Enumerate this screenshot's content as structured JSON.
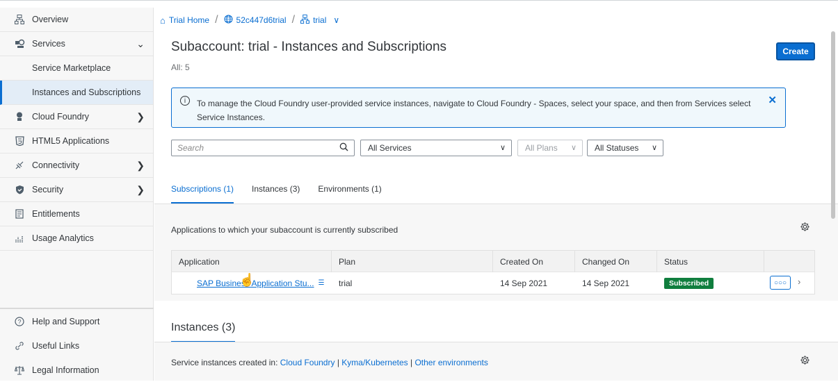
{
  "sidebar": {
    "items": [
      {
        "label": "Overview",
        "icon": "hierarchy-icon"
      },
      {
        "label": "Services",
        "icon": "services-icon"
      },
      {
        "label": "Service Marketplace"
      },
      {
        "label": "Instances and Subscriptions"
      },
      {
        "label": "Cloud Foundry",
        "icon": "cloud-foundry-icon"
      },
      {
        "label": "HTML5 Applications",
        "icon": "html5-icon"
      },
      {
        "label": "Connectivity",
        "icon": "connectivity-icon"
      },
      {
        "label": "Security",
        "icon": "shield-icon"
      },
      {
        "label": "Entitlements",
        "icon": "entitlements-icon"
      },
      {
        "label": "Usage Analytics",
        "icon": "analytics-icon"
      }
    ],
    "bottom": [
      {
        "label": "Help and Support",
        "icon": "help-icon"
      },
      {
        "label": "Useful Links",
        "icon": "link-icon"
      },
      {
        "label": "Legal Information",
        "icon": "legal-icon"
      }
    ]
  },
  "breadcrumb": {
    "home": "Trial Home",
    "account": "52c447d6trial",
    "subaccount": "trial"
  },
  "header": {
    "title": "Subaccount: trial - Instances and Subscriptions",
    "count": "All: 5",
    "create_label": "Create"
  },
  "info": {
    "text": "To manage the Cloud Foundry user-provided service instances, navigate to Cloud Foundry - Spaces, select your space, and then from Services select Service Instances."
  },
  "filters": {
    "search_placeholder": "Search",
    "services": "All Services",
    "plans": "All Plans",
    "statuses": "All Statuses"
  },
  "tabs": [
    "Subscriptions (1)",
    "Instances (3)",
    "Environments (1)"
  ],
  "subscriptions": {
    "description": "Applications to which your subaccount is currently subscribed",
    "columns": [
      "Application",
      "Plan",
      "Created On",
      "Changed On",
      "Status"
    ],
    "rows": [
      {
        "application": "SAP Business Application Stu...",
        "plan": "trial",
        "created": "14 Sep 2021",
        "changed": "14 Sep 2021",
        "status": "Subscribed"
      }
    ]
  },
  "instances": {
    "title": "Instances (3)",
    "prefix": "Service instances created in:",
    "links": [
      "Cloud Foundry",
      "Kyma/Kubernetes",
      "Other environments"
    ]
  },
  "colors": {
    "accent": "#0a6ed1",
    "success": "#107e3e"
  }
}
